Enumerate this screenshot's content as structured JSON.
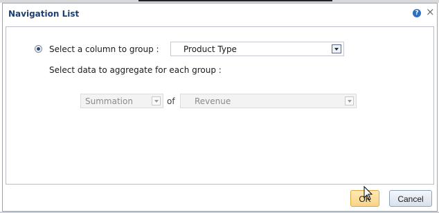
{
  "dialog": {
    "title": "Navigation List",
    "help_icon": "question-icon",
    "help_glyph": "?",
    "close_icon": "close-icon",
    "close_glyph": "×"
  },
  "group": {
    "radio_selected": true,
    "label": "Select a column to group :",
    "selected_value": "Product Type"
  },
  "aggregate": {
    "label": "Select data to aggregate for each group :",
    "function_value": "Summation",
    "of_label": "of",
    "column_value": "Revenue",
    "disabled": true
  },
  "buttons": {
    "ok_label": "OK",
    "cancel_label": "Cancel"
  },
  "colors": {
    "title_text": "#1d3f72",
    "ok_button_fill": "#f9d487",
    "cancel_button_fill": "#d8e1ec",
    "disabled_text": "#8a8a8a"
  }
}
